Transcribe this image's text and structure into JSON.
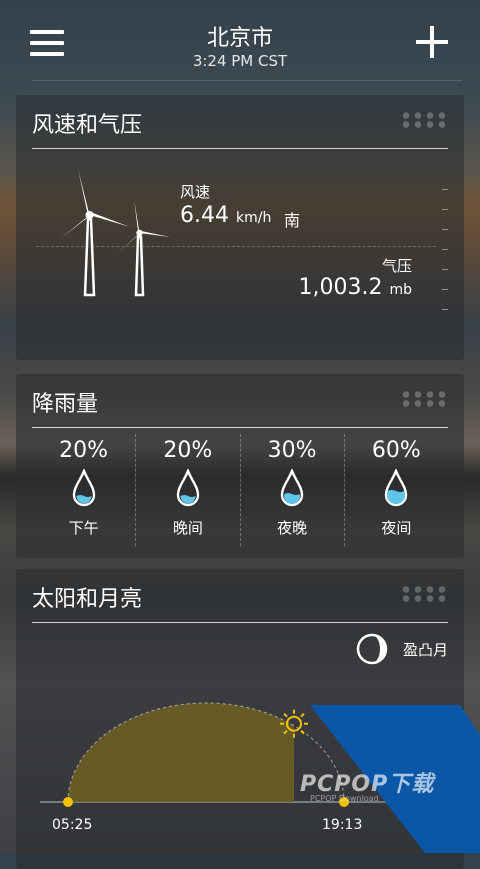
{
  "header": {
    "city": "北京市",
    "time": "3:24 PM CST"
  },
  "wind": {
    "title": "风速和气压",
    "wind_label": "风速",
    "wind_speed": "6.44",
    "wind_unit": "km/h",
    "wind_direction": "南",
    "pressure_label": "气压",
    "pressure_value": "1,003.2",
    "pressure_unit": "mb"
  },
  "rain": {
    "title": "降雨量",
    "items": [
      {
        "pct": "20%",
        "time": "下午"
      },
      {
        "pct": "20%",
        "time": "晚间"
      },
      {
        "pct": "30%",
        "time": "夜晚"
      },
      {
        "pct": "60%",
        "time": "夜间"
      }
    ]
  },
  "sun": {
    "title": "太阳和月亮",
    "moon_phase": "盈凸月",
    "sunrise": "05:25",
    "sunset": "19:13",
    "day_progress": 0.72
  },
  "watermark": {
    "text": "PCPOP下载",
    "sub": "PCPOP Download"
  },
  "colors": {
    "sun_fill": "#6f6022",
    "sun_dot": "#f2c200",
    "drop_water": "#5ec4e8",
    "watermark_blue": "#0a57a8"
  }
}
